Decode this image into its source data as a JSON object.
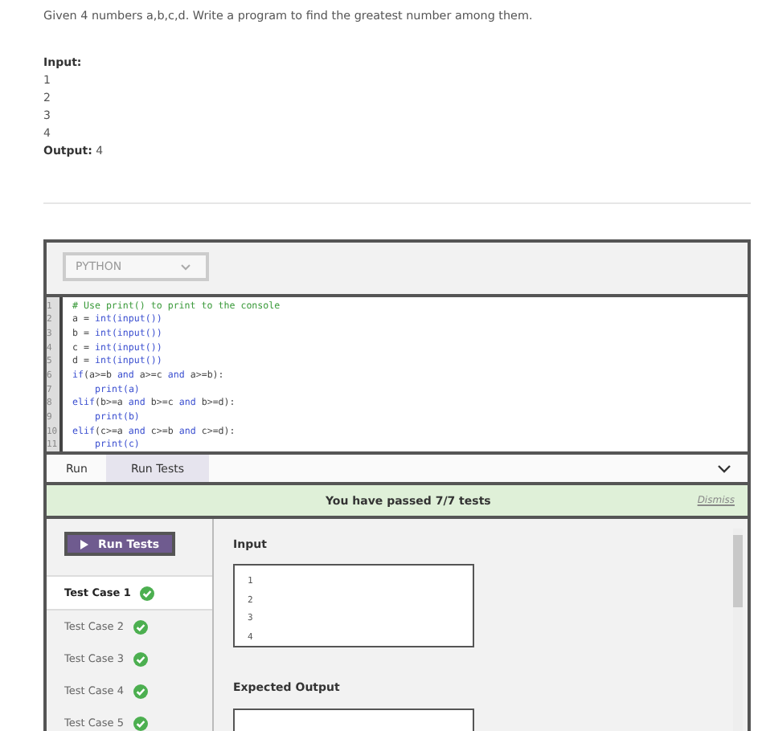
{
  "problem": {
    "statement": "Given 4 numbers a,b,c,d. Write a program to find the greatest number among them.",
    "input_label": "Input:",
    "input_lines": [
      "1",
      "2",
      "3",
      "4"
    ],
    "output_label": "Output:",
    "output_value": "4"
  },
  "editor": {
    "language": "PYTHON",
    "lines": [
      {
        "indented": false,
        "segments": [
          {
            "kind": "comment",
            "text": "# Use print() to print to the console"
          }
        ]
      },
      {
        "indented": false,
        "segments": [
          {
            "kind": "plain",
            "text": "a = "
          },
          {
            "kind": "keyword",
            "text": "int(input())"
          }
        ]
      },
      {
        "indented": false,
        "segments": [
          {
            "kind": "plain",
            "text": "b = "
          },
          {
            "kind": "keyword",
            "text": "int(input())"
          }
        ]
      },
      {
        "indented": false,
        "segments": [
          {
            "kind": "plain",
            "text": "c = "
          },
          {
            "kind": "keyword",
            "text": "int(input())"
          }
        ]
      },
      {
        "indented": false,
        "segments": [
          {
            "kind": "plain",
            "text": "d = "
          },
          {
            "kind": "keyword",
            "text": "int(input())"
          }
        ]
      },
      {
        "indented": false,
        "segments": [
          {
            "kind": "keyword",
            "text": "if"
          },
          {
            "kind": "plain",
            "text": "(a>=b "
          },
          {
            "kind": "keyword",
            "text": "and"
          },
          {
            "kind": "plain",
            "text": " a>=c "
          },
          {
            "kind": "keyword",
            "text": "and"
          },
          {
            "kind": "plain",
            "text": " a>=b):"
          }
        ]
      },
      {
        "indented": true,
        "segments": [
          {
            "kind": "keyword",
            "text": "print(a)"
          }
        ]
      },
      {
        "indented": false,
        "segments": [
          {
            "kind": "keyword",
            "text": "elif"
          },
          {
            "kind": "plain",
            "text": "(b>=a "
          },
          {
            "kind": "keyword",
            "text": "and"
          },
          {
            "kind": "plain",
            "text": " b>=c "
          },
          {
            "kind": "keyword",
            "text": "and"
          },
          {
            "kind": "plain",
            "text": " b>=d):"
          }
        ]
      },
      {
        "indented": true,
        "segments": [
          {
            "kind": "keyword",
            "text": "print(b)"
          }
        ]
      },
      {
        "indented": false,
        "segments": [
          {
            "kind": "keyword",
            "text": "elif"
          },
          {
            "kind": "plain",
            "text": "(c>=a "
          },
          {
            "kind": "keyword",
            "text": "and"
          },
          {
            "kind": "plain",
            "text": " c>=b "
          },
          {
            "kind": "keyword",
            "text": "and"
          },
          {
            "kind": "plain",
            "text": " c>=d):"
          }
        ]
      },
      {
        "indented": true,
        "segments": [
          {
            "kind": "keyword",
            "text": "print(c)"
          }
        ]
      }
    ],
    "line_numbers": [
      "1",
      "2",
      "3",
      "4",
      "5",
      "6",
      "7",
      "8",
      "9",
      "10",
      "11"
    ]
  },
  "tabs": [
    {
      "label": "Run",
      "selected": false
    },
    {
      "label": "Run Tests",
      "selected": true
    }
  ],
  "banner": {
    "message": "You have passed 7/7 tests",
    "dismiss": "Dismiss"
  },
  "run_button": "Run Tests",
  "test_cases": [
    {
      "label": "Test Case 1",
      "selected": true,
      "passed": true
    },
    {
      "label": "Test Case 2",
      "selected": false,
      "passed": true
    },
    {
      "label": "Test Case 3",
      "selected": false,
      "passed": true
    },
    {
      "label": "Test Case 4",
      "selected": false,
      "passed": true
    },
    {
      "label": "Test Case 5",
      "selected": false,
      "passed": true
    }
  ],
  "detail": {
    "input_label": "Input",
    "input_lines": [
      "1",
      "2",
      "3",
      "4"
    ],
    "expected_label": "Expected Output"
  }
}
